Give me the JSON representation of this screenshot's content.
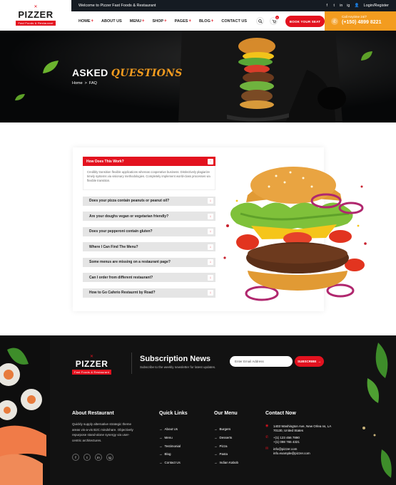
{
  "brand": {
    "name": "PIZZER",
    "tagline": "Fast Foods & Restaurant"
  },
  "topbar": {
    "welcome": "Welcome to Pizzer Fast Foods & Restaurant",
    "social": [
      "f",
      "t",
      "in",
      "ig"
    ],
    "login": "Login/Register"
  },
  "nav": {
    "items": [
      {
        "label": "HOME",
        "has_dropdown": true
      },
      {
        "label": "ABOUT US",
        "has_dropdown": false
      },
      {
        "label": "MENU",
        "has_dropdown": true
      },
      {
        "label": "SHOP",
        "has_dropdown": true
      },
      {
        "label": "PAGES",
        "has_dropdown": true
      },
      {
        "label": "BLOG",
        "has_dropdown": true
      },
      {
        "label": "CONTACT US",
        "has_dropdown": false
      }
    ],
    "cart_count": "0",
    "book_button": "BOOK YOUR SEAT",
    "call_label": "Call Anytime 24/7",
    "call_number": "(+150) 4899 8221"
  },
  "hero": {
    "title_white": "ASKED",
    "title_accent": "QUESTIONS",
    "breadcrumb_home": "Home",
    "breadcrumb_sep": ">",
    "breadcrumb_current": "FAQ"
  },
  "faq": {
    "open": {
      "question": "How Does This Work?",
      "answer": "Credibly transition flexible applications whereas cooperative business. Distinctively plagiarize timely systems via visionary methodologies. Completely implement world-class processes via flexible transition."
    },
    "questions": [
      "Does your pizza contain peanuts or peanut oil?",
      "Are your doughs vegan or vegetarian friendly?",
      "Does your pepperoni contain gluten?",
      "Where I Can Find The Menu?",
      "Some menus are missing on a restaurant page?",
      "Can I order from different restaurant?",
      "How to Go Caferio Restaurnt by Road?"
    ]
  },
  "footer": {
    "subscription_title": "Subscription News",
    "subscription_desc": "Subscribe to the weekly newsletter for latest updates.",
    "email_placeholder": "Enter Email Address",
    "subscribe_button": "SUBSCRIBE",
    "about_title": "About Restaurant",
    "about_text": "Quickly supply alternative strategic theme areas vis-a-vis B2C mindshare. Objectively repurpose stand-alone synergy via user-centric architectures.",
    "social": [
      "f",
      "t",
      "in",
      "ig"
    ],
    "quick_links_title": "Quick Links",
    "quick_links": [
      "About Us",
      "Menu",
      "Testimonial",
      "Blog",
      "Contact Us"
    ],
    "menu_title": "Our Menu",
    "menu_items": [
      "Burgers",
      "Desserts",
      "Pizza",
      "Pasta",
      "Indian Kabob"
    ],
    "contact_title": "Contact Now",
    "address": "1403 Washington Ave, New Orlea ns, LA 70130, United States",
    "phones": [
      "+(1) 123 456 7890",
      "+(1) 098 765 4321"
    ],
    "emails": [
      "info@pizzer.com",
      "info.example@pizzer.com"
    ]
  },
  "colors": {
    "accent_red": "#e3121f",
    "accent_orange": "#f39c1f",
    "dark": "#121212"
  }
}
